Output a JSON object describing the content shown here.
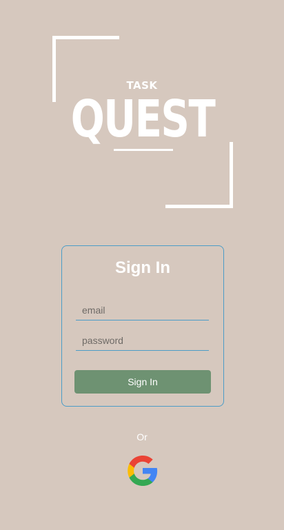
{
  "logo": {
    "small_text": "TASK",
    "main_text": "QUEST"
  },
  "signin_card": {
    "title": "Sign In",
    "email_placeholder": "email",
    "password_placeholder": "password",
    "submit_label": "Sign In"
  },
  "alt_login": {
    "separator": "Or",
    "provider_icon": "google-icon"
  },
  "colors": {
    "background": "#d6c8be",
    "accent_border": "#4b9cc7",
    "button": "#6e9272",
    "text": "#ffffff"
  }
}
